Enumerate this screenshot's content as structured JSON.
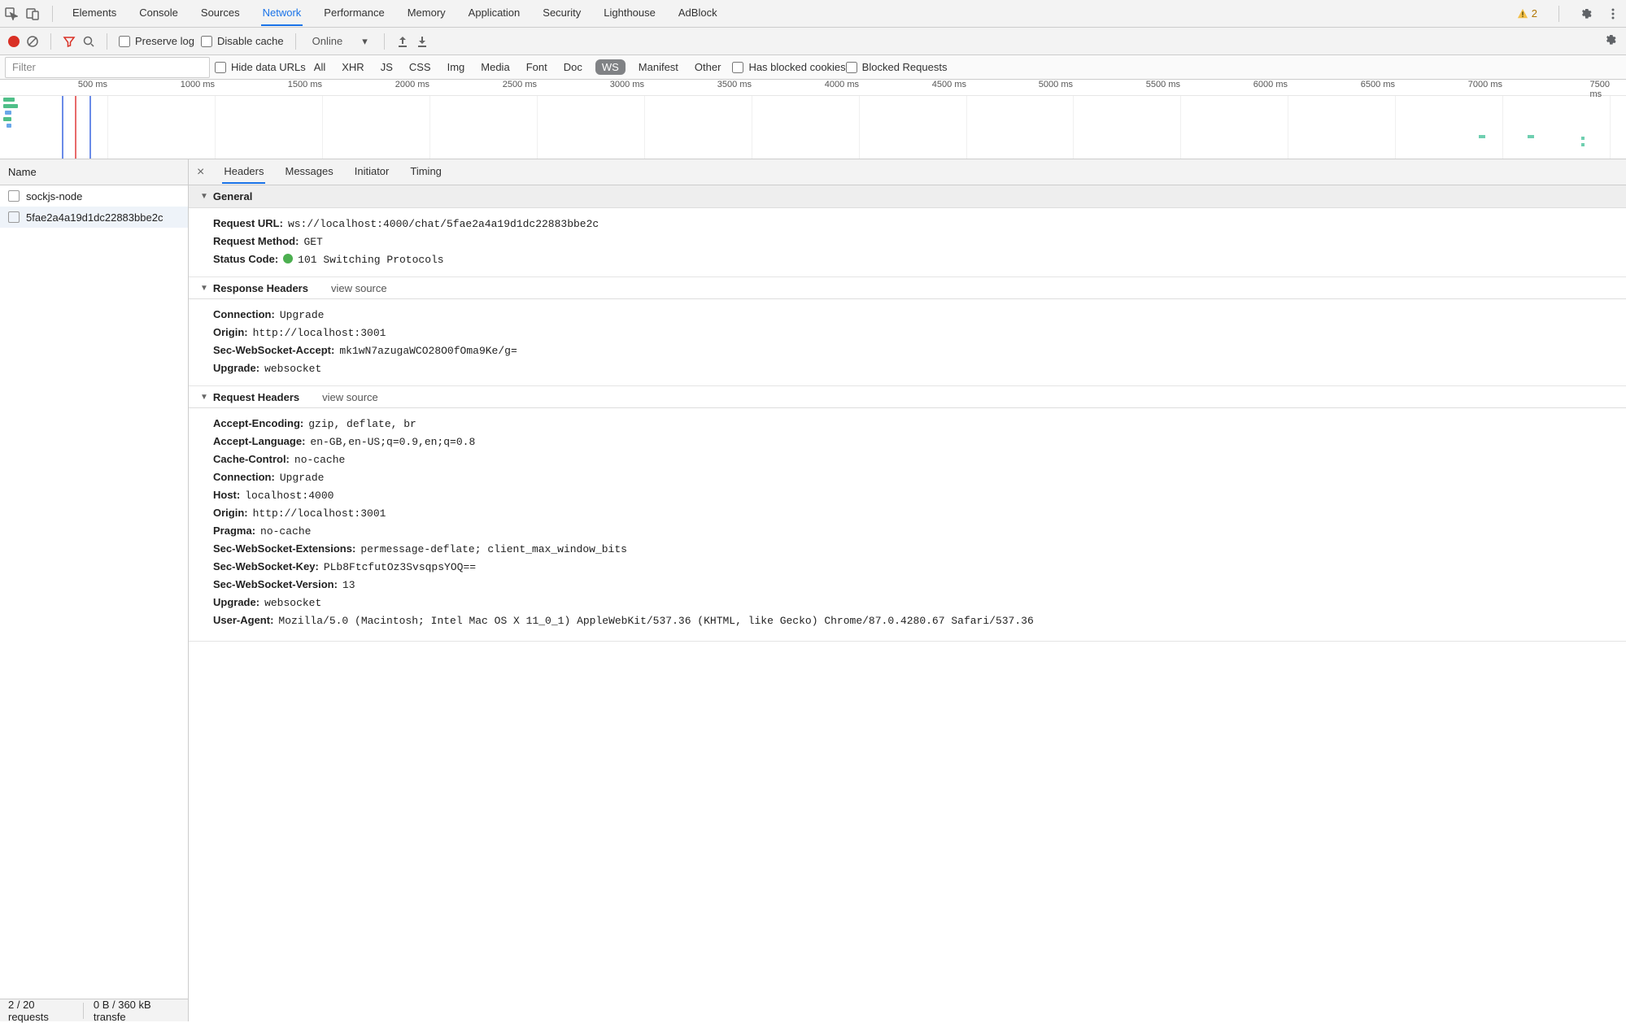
{
  "mainTabs": {
    "items": [
      "Elements",
      "Console",
      "Sources",
      "Network",
      "Performance",
      "Memory",
      "Application",
      "Security",
      "Lighthouse",
      "AdBlock"
    ],
    "activeIndex": 3,
    "warningCount": "2"
  },
  "toolbar": {
    "preserveLog": "Preserve log",
    "disableCache": "Disable cache",
    "throttling": "Online"
  },
  "filterBar": {
    "placeholder": "Filter",
    "hideDataUrls": "Hide data URLs",
    "types": [
      "All",
      "XHR",
      "JS",
      "CSS",
      "Img",
      "Media",
      "Font",
      "Doc",
      "WS",
      "Manifest",
      "Other"
    ],
    "activeType": "WS",
    "hasBlockedCookies": "Has blocked cookies",
    "blockedRequests": "Blocked Requests"
  },
  "timeline": {
    "ticks": [
      "500 ms",
      "1000 ms",
      "1500 ms",
      "2000 ms",
      "2500 ms",
      "3000 ms",
      "3500 ms",
      "4000 ms",
      "4500 ms",
      "5000 ms",
      "5500 ms",
      "6000 ms",
      "6500 ms",
      "7000 ms",
      "7500 ms"
    ]
  },
  "sidebar": {
    "head": "Name",
    "rows": [
      "sockjs-node",
      "5fae2a4a19d1dc22883bbe2c"
    ],
    "selectedIndex": 1
  },
  "statusBar": {
    "requests": "2 / 20 requests",
    "transfer": "0 B / 360 kB transfe"
  },
  "detailsTabs": {
    "items": [
      "Headers",
      "Messages",
      "Initiator",
      "Timing"
    ],
    "activeIndex": 0
  },
  "general": {
    "title": "General",
    "items": [
      {
        "k": "Request URL:",
        "v": "ws://localhost:4000/chat/5fae2a4a19d1dc22883bbe2c"
      },
      {
        "k": "Request Method:",
        "v": "GET"
      },
      {
        "k": "Status Code:",
        "v": "101 Switching Protocols",
        "status": true
      }
    ]
  },
  "responseHeaders": {
    "title": "Response Headers",
    "viewSource": "view source",
    "items": [
      {
        "k": "Connection:",
        "v": "Upgrade"
      },
      {
        "k": "Origin:",
        "v": "http://localhost:3001"
      },
      {
        "k": "Sec-WebSocket-Accept:",
        "v": "mk1wN7azugaWCO28O0fOma9Ke/g="
      },
      {
        "k": "Upgrade:",
        "v": "websocket"
      }
    ]
  },
  "requestHeaders": {
    "title": "Request Headers",
    "viewSource": "view source",
    "items": [
      {
        "k": "Accept-Encoding:",
        "v": "gzip, deflate, br"
      },
      {
        "k": "Accept-Language:",
        "v": "en-GB,en-US;q=0.9,en;q=0.8"
      },
      {
        "k": "Cache-Control:",
        "v": "no-cache"
      },
      {
        "k": "Connection:",
        "v": "Upgrade"
      },
      {
        "k": "Host:",
        "v": "localhost:4000"
      },
      {
        "k": "Origin:",
        "v": "http://localhost:3001"
      },
      {
        "k": "Pragma:",
        "v": "no-cache"
      },
      {
        "k": "Sec-WebSocket-Extensions:",
        "v": "permessage-deflate; client_max_window_bits"
      },
      {
        "k": "Sec-WebSocket-Key:",
        "v": "PLb8FtcfutOz3SvsqpsYOQ=="
      },
      {
        "k": "Sec-WebSocket-Version:",
        "v": "13"
      },
      {
        "k": "Upgrade:",
        "v": "websocket"
      },
      {
        "k": "User-Agent:",
        "v": "Mozilla/5.0 (Macintosh; Intel Mac OS X 11_0_1) AppleWebKit/537.36 (KHTML, like Gecko) Chrome/87.0.4280.67 Safari/537.36"
      }
    ]
  }
}
